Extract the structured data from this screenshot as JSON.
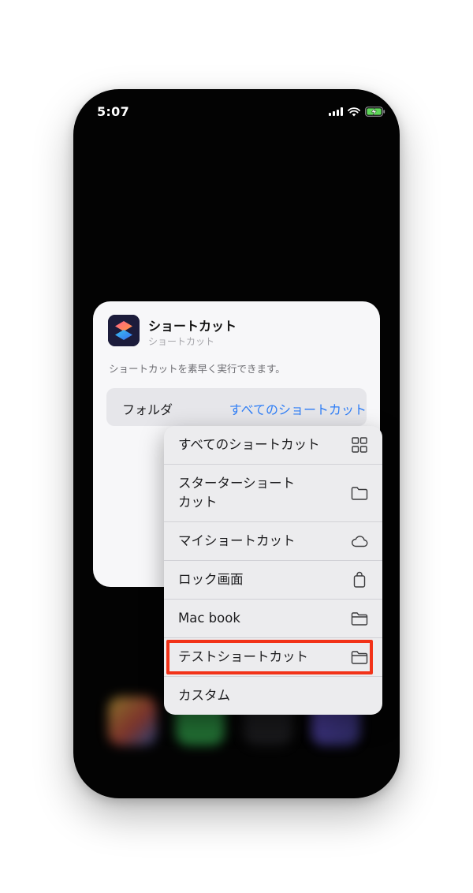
{
  "status_bar": {
    "time": "5:07",
    "icons": [
      "signal-icon",
      "wifi-icon",
      "battery-charging-icon"
    ]
  },
  "widget": {
    "app_icon": "shortcuts-app-icon",
    "title": "ショートカット",
    "subtitle": "ショートカット",
    "description": "ショートカットを素早く実行できます。",
    "folder_label": "フォルダ",
    "folder_value": "すべてのショートカット"
  },
  "menu": {
    "items": [
      {
        "label": "すべてのショートカット",
        "icon": "grid-icon"
      },
      {
        "label": "スターターショート\nカット",
        "icon": "folder-icon"
      },
      {
        "label": "マイショートカット",
        "icon": "cloud-icon"
      },
      {
        "label": "ロック画面",
        "icon": "bag-icon"
      },
      {
        "label": "Mac book",
        "icon": "folder-icon"
      },
      {
        "label": "テストショートカット",
        "icon": "folder-icon",
        "highlighted": true
      },
      {
        "label": "カスタム",
        "icon": ""
      }
    ]
  },
  "colors": {
    "accent": "#2f7ef6",
    "highlight": "#f23218",
    "phone_background": "#030303",
    "widget_background": "#f7f7f9",
    "menu_background": "#ececee"
  }
}
